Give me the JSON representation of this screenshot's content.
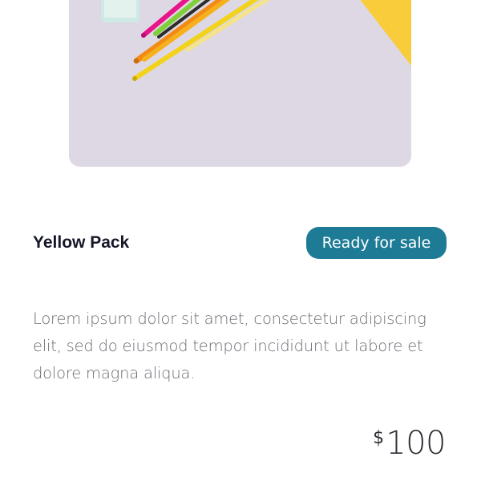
{
  "product": {
    "title": "Yellow Pack",
    "status_badge": "Ready for sale",
    "description": "Lorem ipsum dolor sit amet, consectetur adipiscing elit, sed do eiusmod tempor incididunt ut labore et dolore magna aliqua.",
    "price_currency": "$",
    "price_amount": "100"
  },
  "colors": {
    "badge_bg": "#1e7b96",
    "title_text": "#15182a",
    "description_text": "#6b6b73",
    "image_bg": "#ddd8e3",
    "accent_yellow": "#f8cc3a"
  }
}
